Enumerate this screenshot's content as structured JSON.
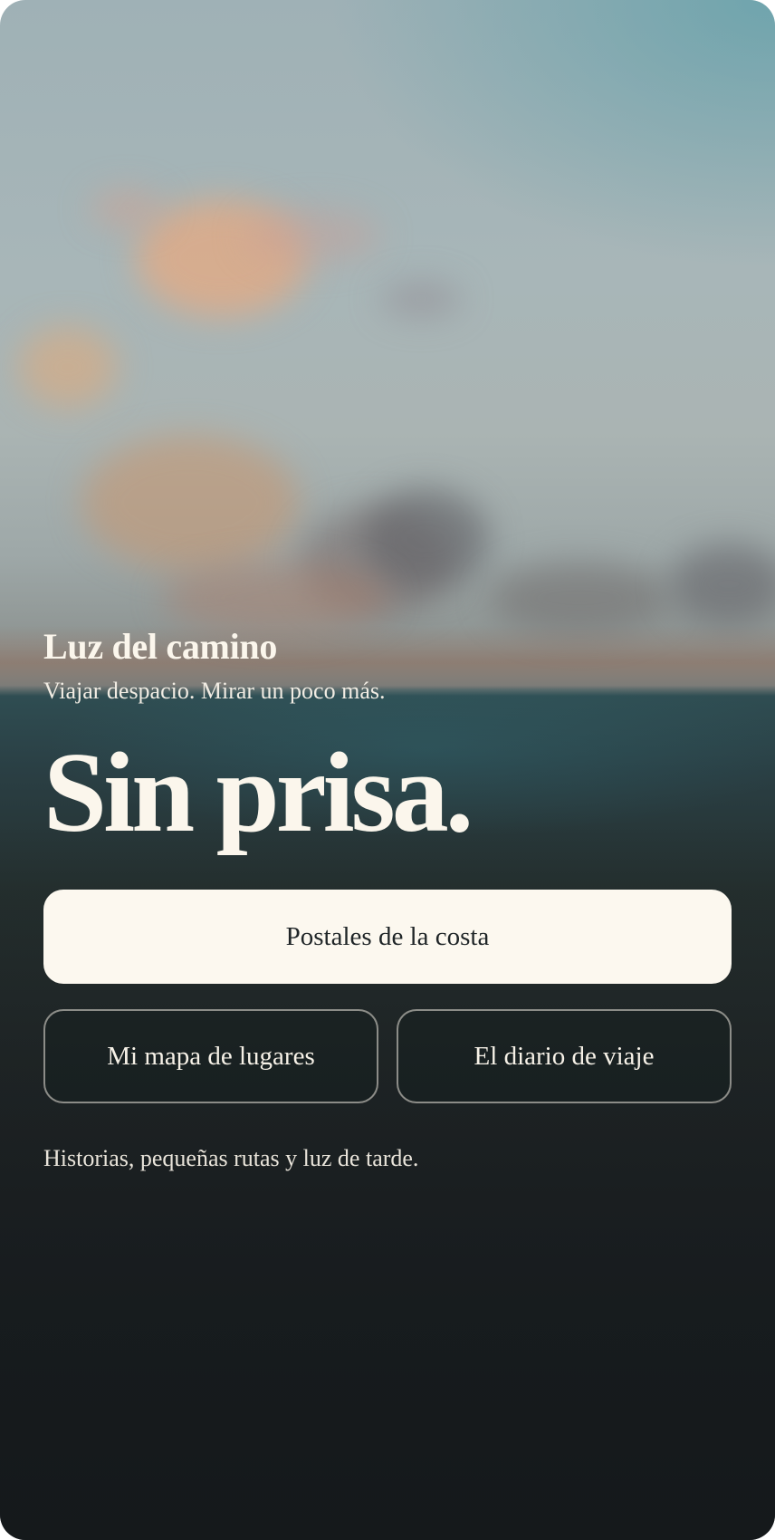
{
  "app": {
    "brand": "Luz del camino",
    "tagline": "Viajar despacio. Mirar un poco más."
  },
  "hero": {
    "headline": "Sin prisa."
  },
  "actions": {
    "primary_label": "Postales de la costa",
    "secondary": [
      {
        "label": "Mi mapa de lugares"
      },
      {
        "label": "El diario de viaje"
      }
    ]
  },
  "footer": {
    "note": "Historias, pequeñas rutas y luz de tarde."
  },
  "colors": {
    "primary_button_bg": "#fcf8ef",
    "primary_button_text": "#1f2527",
    "text_light": "#fbf6ec",
    "outline_border": "#ebe6dc"
  }
}
